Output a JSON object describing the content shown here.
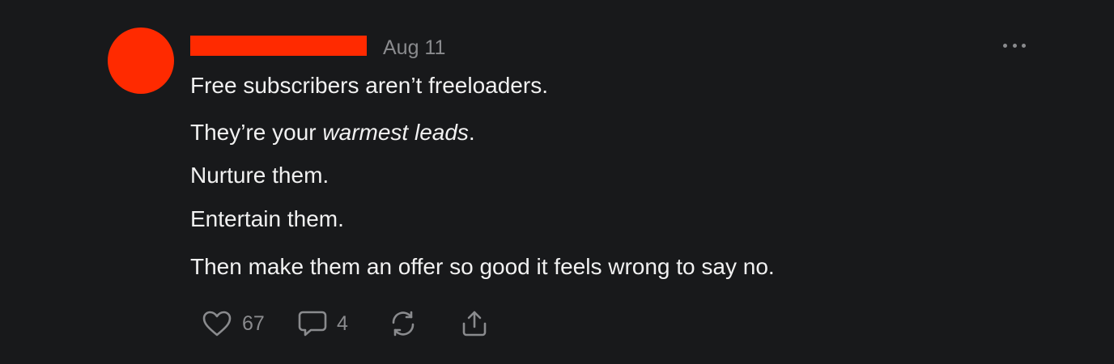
{
  "note": {
    "avatar_color": "#ff2a00",
    "redaction_color": "#ff2a00",
    "date": "Aug 11",
    "more_icon": "ellipsis-icon",
    "body": {
      "line1": "Free subscribers aren’t freeloaders.",
      "line2_prefix": "They’re your ",
      "line2_emphasis": "warmest leads",
      "line2_suffix": ".",
      "line3": "Nurture them.",
      "line4": "Entertain them.",
      "line5": "Then make them an offer so good it feels wrong to say no."
    },
    "actions": {
      "likes": "67",
      "comments": "4",
      "like_icon": "heart-icon",
      "comment_icon": "comment-bubble-icon",
      "restack_icon": "restack-icon",
      "share_icon": "share-icon"
    }
  }
}
